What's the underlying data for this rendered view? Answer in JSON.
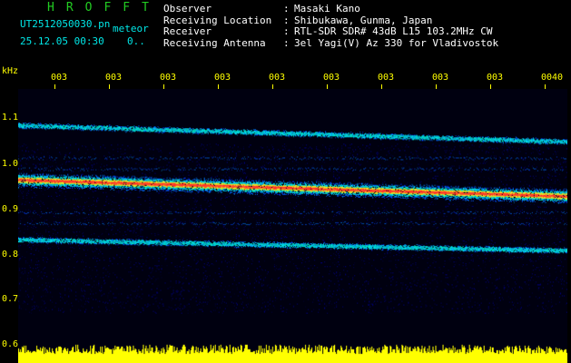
{
  "header": {
    "brand": "HROFFT",
    "filename": "UT2512050030.pn",
    "mode": "meteor",
    "datetime": "25.12.05 00:30",
    "counter": "0.."
  },
  "info": [
    {
      "label": "Observer",
      "value": "Masaki Kano"
    },
    {
      "label": "Receiving Location",
      "value": "Shibukawa, Gunma, Japan"
    },
    {
      "label": "Receiver",
      "value": "RTL-SDR SDR# 43dB L15 103.2MHz CW"
    },
    {
      "label": "Receiving Antenna",
      "value": "3el Yagi(V) Az 330 for Vladivostok"
    }
  ],
  "chart_data": {
    "type": "heatmap",
    "ylabel": "kHz",
    "y_ticks": [
      "1.1",
      "1.0",
      "0.9",
      "0.8",
      "0.7",
      "0.6"
    ],
    "ylim": [
      0.6,
      1.1
    ],
    "x_ticks": [
      "003",
      "003",
      "003",
      "003",
      "003",
      "003",
      "003",
      "003",
      "003",
      "0040"
    ],
    "traces": [
      {
        "y_start": 1.02,
        "y_end": 0.99
      },
      {
        "y_start": 0.92,
        "y_end": 0.89
      },
      {
        "y_start": 0.81,
        "y_end": 0.79
      }
    ]
  },
  "colors": {
    "axis": "#ffff00",
    "brand": "#22cc22",
    "file": "#00e8e8",
    "info": "#ffffff",
    "noise_floor": "#ffff00"
  }
}
